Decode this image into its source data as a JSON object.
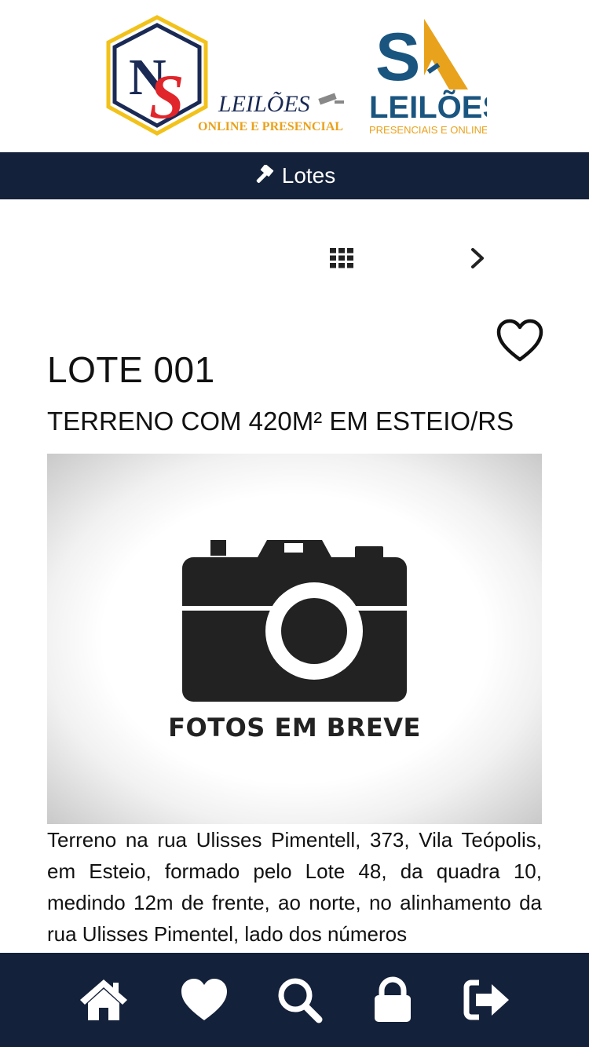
{
  "header": {
    "logo_left": {
      "line1": "LEILÕES",
      "line2": "ONLINE E PRESENCIAL",
      "monogram": "NS"
    },
    "logo_right": {
      "monogram": "SA",
      "line1": "LEILÕES",
      "line2": "PRESENCIAIS E ONLINE"
    }
  },
  "nav": {
    "label": "Lotes",
    "icon": "gavel-icon"
  },
  "toolbar": {
    "grid_icon": "grid-icon",
    "next_icon": "chevron-right-icon"
  },
  "lot": {
    "title": "LOTE 001",
    "subtitle": "TERRENO COM 420M² EM ESTEIO/RS",
    "photo_caption": "FOTOS EM BREVE",
    "description": "Terreno na rua Ulisses Pimentell, 373, Vila Teópolis, em Esteio, formado pelo Lote 48, da quadra 10, medindo 12m de frente, ao norte, no alinhamento da rua Ulisses Pimentel, lado dos números"
  },
  "bottom_nav": {
    "items": [
      {
        "icon": "home-icon"
      },
      {
        "icon": "heart-icon"
      },
      {
        "icon": "search-icon"
      },
      {
        "icon": "lock-icon"
      },
      {
        "icon": "sign-out-icon"
      }
    ]
  },
  "colors": {
    "nav_bg": "#14213a",
    "brand_blue": "#1a3a6b",
    "brand_red": "#e0262b",
    "brand_yellow": "#f2c21b",
    "brand_orange": "#e9a21c"
  }
}
